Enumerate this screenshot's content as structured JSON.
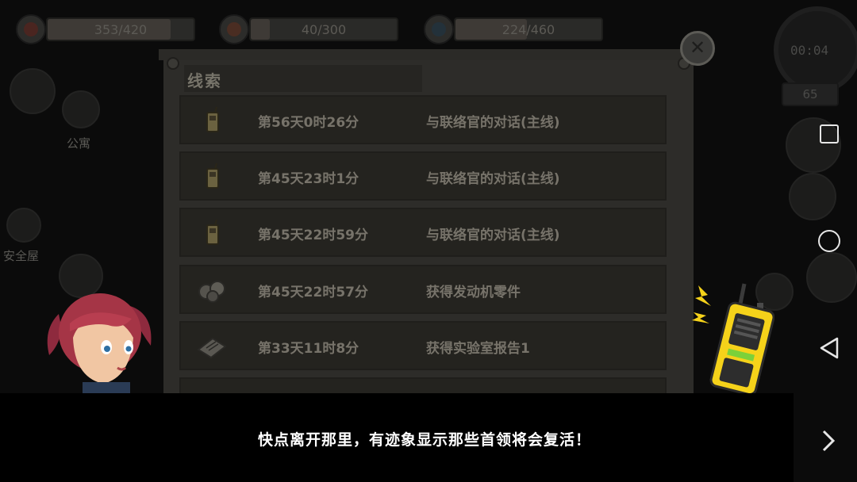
{
  "hud": {
    "health": "353/420",
    "hunger": "40/300",
    "water": "224/460",
    "health_ratio": 0.84,
    "hunger_ratio": 0.13,
    "water_ratio": 0.49,
    "timer": "00:04",
    "day": "65"
  },
  "map": {
    "apartment_label": "公寓",
    "safehouse_label": "安全屋"
  },
  "panel": {
    "title": "线索",
    "close_icon": "close-icon",
    "clues": [
      {
        "time": "第56天0时26分",
        "desc": "与联络官的对话(主线)",
        "icon": "walkie-talkie-icon"
      },
      {
        "time": "第45天23时1分",
        "desc": "与联络官的对话(主线)",
        "icon": "walkie-talkie-icon"
      },
      {
        "time": "第45天22时59分",
        "desc": "与联络官的对话(主线)",
        "icon": "walkie-talkie-icon"
      },
      {
        "time": "第45天22时57分",
        "desc": "获得发动机零件",
        "icon": "engine-parts-icon"
      },
      {
        "time": "第33天11时8分",
        "desc": "获得实验室报告1",
        "icon": "lab-report-icon"
      }
    ]
  },
  "dialog": {
    "text": "快点离开那里，有迹象显示那些首领将会复活！",
    "next_icon": "chevron-right-icon"
  },
  "nav": {
    "recents_icon": "square-recents-icon",
    "home_icon": "circle-home-icon",
    "back_icon": "triangle-back-icon"
  },
  "colors": {
    "accent_yellow": "#f5d21a",
    "dialog_text": "#ffffff",
    "panel_bg": "#2d2c29"
  }
}
